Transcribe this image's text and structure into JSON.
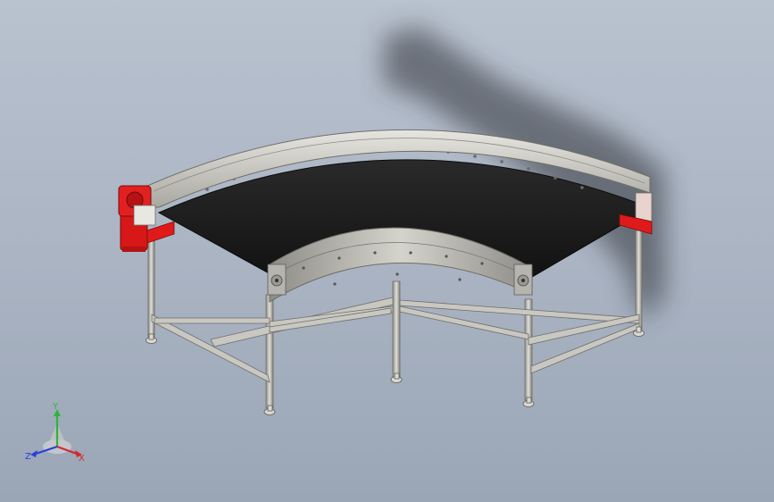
{
  "triad": {
    "x_label": "X",
    "y_label": "Y",
    "z_label": "Z"
  },
  "colors": {
    "background_top": "#b9c2cf",
    "background_bottom": "#9aa6b6",
    "belt": "#1e1e1e",
    "frame": "#c9c8c2",
    "motor": "#e01a1a",
    "axis_x": "#d8262a",
    "axis_y": "#2fb43c",
    "axis_z": "#2c3fd8"
  },
  "icons": [
    "triad-icon",
    "drive-motor-icon"
  ]
}
